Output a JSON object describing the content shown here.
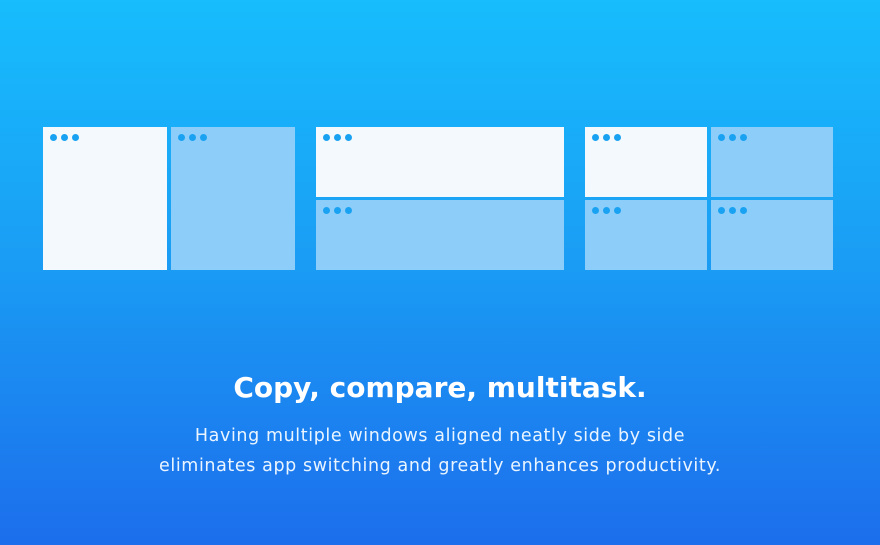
{
  "headline": "Copy, compare, multitask.",
  "subtitle": {
    "line1": "Having multiple windows aligned neatly side by side",
    "line2": "eliminates app switching and greatly enhances productivity."
  },
  "layouts": [
    {
      "name": "two-columns",
      "windows": [
        "light",
        "blue"
      ]
    },
    {
      "name": "two-rows",
      "windows": [
        "light",
        "blue"
      ]
    },
    {
      "name": "four-quadrants",
      "windows": [
        "light",
        "blue",
        "blue",
        "blue"
      ]
    }
  ],
  "colors": {
    "gradient_top": "#17bdfd",
    "gradient_bottom": "#1c6eec",
    "window_light": "#f3f9fd",
    "window_blue": "#8ccdf9",
    "title_dots": "#1aa2f2",
    "text": "#ffffff"
  }
}
